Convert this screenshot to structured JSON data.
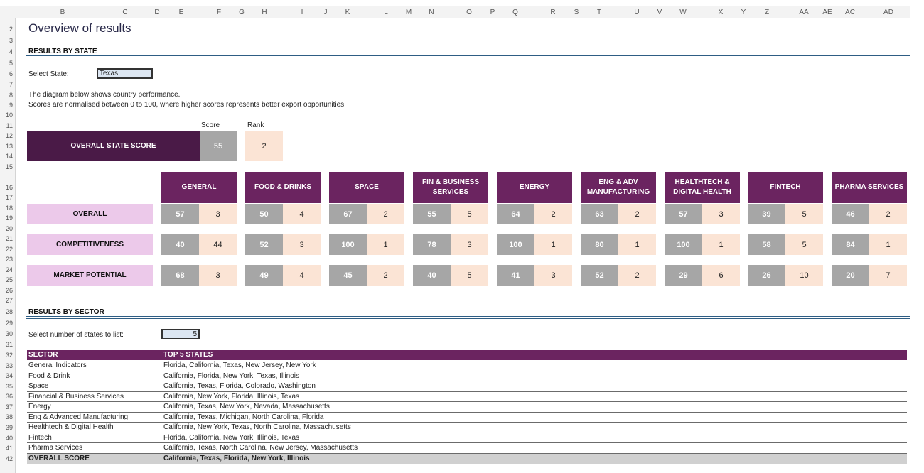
{
  "column_headers": [
    "B",
    "C",
    "D",
    "E",
    "F",
    "G",
    "H",
    "I",
    "J",
    "K",
    "L",
    "M",
    "N",
    "O",
    "P",
    "Q",
    "R",
    "S",
    "T",
    "U",
    "V",
    "W",
    "X",
    "Y",
    "Z",
    "AA",
    "AE",
    "AC",
    "AD"
  ],
  "row_headers": [
    "2",
    "3",
    "4",
    "5",
    "6",
    "7",
    "8",
    "9",
    "10",
    "11",
    "12",
    "13",
    "14",
    "15",
    "16",
    "17",
    "18",
    "19",
    "20",
    "21",
    "22",
    "23",
    "24",
    "25",
    "26",
    "27",
    "28",
    "29",
    "30",
    "31",
    "32",
    "33",
    "34",
    "35",
    "36",
    "37",
    "38",
    "39",
    "40",
    "41",
    "42"
  ],
  "title": "Overview of results",
  "results_by_state": {
    "heading": "RESULTS BY STATE",
    "select_label": "Select State:",
    "selected_state": "Texas",
    "note_line1": "The diagram below shows country performance.",
    "note_line2": "Scores are normalised between 0 to 100, where higher scores represents better export opportunities",
    "score_header": "Score",
    "rank_header": "Rank",
    "overall_label": "OVERALL STATE SCORE",
    "overall_score": "55",
    "overall_rank": "2",
    "metrics": [
      "OVERALL",
      "COMPETITIVENESS",
      "MARKET POTENTIAL"
    ],
    "sectors": [
      {
        "name": "GENERAL",
        "values": [
          [
            "57",
            "3"
          ],
          [
            "40",
            "44"
          ],
          [
            "68",
            "3"
          ]
        ]
      },
      {
        "name": "FOOD & DRINKS",
        "values": [
          [
            "50",
            "4"
          ],
          [
            "52",
            "3"
          ],
          [
            "49",
            "4"
          ]
        ]
      },
      {
        "name": "SPACE",
        "values": [
          [
            "67",
            "2"
          ],
          [
            "100",
            "1"
          ],
          [
            "45",
            "2"
          ]
        ]
      },
      {
        "name": "FIN & BUSINESS SERVICES",
        "values": [
          [
            "55",
            "5"
          ],
          [
            "78",
            "3"
          ],
          [
            "40",
            "5"
          ]
        ]
      },
      {
        "name": "ENERGY",
        "values": [
          [
            "64",
            "2"
          ],
          [
            "100",
            "1"
          ],
          [
            "41",
            "3"
          ]
        ]
      },
      {
        "name": "ENG & ADV MANUFACTURING",
        "values": [
          [
            "63",
            "2"
          ],
          [
            "80",
            "1"
          ],
          [
            "52",
            "2"
          ]
        ]
      },
      {
        "name": "HEALTHTECH & DIGITAL HEALTH",
        "values": [
          [
            "57",
            "3"
          ],
          [
            "100",
            "1"
          ],
          [
            "29",
            "6"
          ]
        ]
      },
      {
        "name": "FINTECH",
        "values": [
          [
            "39",
            "5"
          ],
          [
            "58",
            "5"
          ],
          [
            "26",
            "10"
          ]
        ]
      },
      {
        "name": "PHARMA SERVICES",
        "values": [
          [
            "46",
            "2"
          ],
          [
            "84",
            "1"
          ],
          [
            "20",
            "7"
          ]
        ]
      }
    ]
  },
  "results_by_sector": {
    "heading": "RESULTS BY SECTOR",
    "select_label": "Select number of states to list:",
    "num_states": "5",
    "col_sector": "SECTOR",
    "col_top": "TOP 5 STATES",
    "rows": [
      {
        "sector": "General Indicators",
        "states": "Florida, California, Texas, New Jersey, New York"
      },
      {
        "sector": "Food & Drink",
        "states": "California, Florida, New York, Texas, Illinois"
      },
      {
        "sector": "Space",
        "states": "California, Texas, Florida, Colorado, Washington"
      },
      {
        "sector": "Financial & Business Services",
        "states": "California, New York, Florida, Illinois, Texas"
      },
      {
        "sector": "Energy",
        "states": "California, Texas, New York, Nevada, Massachusetts"
      },
      {
        "sector": "Eng & Advanced Manufacturing",
        "states": "California, Texas, Michigan, North Carolina, Florida"
      },
      {
        "sector": "Healthtech & Digital Health",
        "states": "California, New York, Texas, North Carolina, Massachusetts"
      },
      {
        "sector": "Fintech",
        "states": "Florida, California, New York, Illinois, Texas"
      },
      {
        "sector": "Pharma Services",
        "states": "California, Texas, North Carolina, New Jersey, Massachusetts"
      }
    ],
    "total": {
      "sector": "OVERALL SCORE",
      "states": "California, Texas, Florida, New York, Illinois"
    }
  }
}
